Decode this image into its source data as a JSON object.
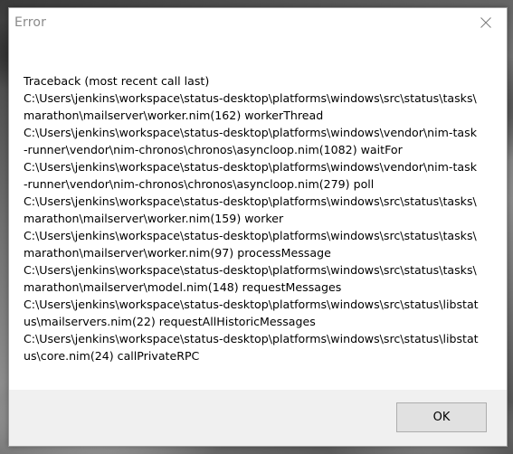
{
  "window": {
    "title": "Error"
  },
  "icons": {
    "close": "close-icon"
  },
  "message": {
    "lines": [
      "Traceback (most recent call last)",
      "C:\\Users\\jenkins\\workspace\\status-desktop\\platforms\\windows\\src\\status\\tasks\\",
      "marathon\\mailserver\\worker.nim(162) workerThread",
      "C:\\Users\\jenkins\\workspace\\status-desktop\\platforms\\windows\\vendor\\nim-task",
      "-runner\\vendor\\nim-chronos\\chronos\\asyncloop.nim(1082) waitFor",
      "C:\\Users\\jenkins\\workspace\\status-desktop\\platforms\\windows\\vendor\\nim-task",
      "-runner\\vendor\\nim-chronos\\chronos\\asyncloop.nim(279) poll",
      "C:\\Users\\jenkins\\workspace\\status-desktop\\platforms\\windows\\src\\status\\tasks\\",
      "marathon\\mailserver\\worker.nim(159) worker",
      "C:\\Users\\jenkins\\workspace\\status-desktop\\platforms\\windows\\src\\status\\tasks\\",
      "marathon\\mailserver\\worker.nim(97) processMessage",
      "C:\\Users\\jenkins\\workspace\\status-desktop\\platforms\\windows\\src\\status\\tasks\\",
      "marathon\\mailserver\\model.nim(148) requestMessages",
      "C:\\Users\\jenkins\\workspace\\status-desktop\\platforms\\windows\\src\\status\\libstat",
      "us\\mailservers.nim(22) requestAllHistoricMessages",
      "C:\\Users\\jenkins\\workspace\\status-desktop\\platforms\\windows\\src\\status\\libstat",
      "us\\core.nim(24) callPrivateRPC"
    ]
  },
  "buttons": {
    "ok_label": "OK"
  },
  "colors": {
    "dialog_background": "#ffffff",
    "footer_background": "#f0f0f0",
    "title_text": "#8a8a8a",
    "button_background": "#e1e1e1",
    "button_border": "#adadad"
  }
}
